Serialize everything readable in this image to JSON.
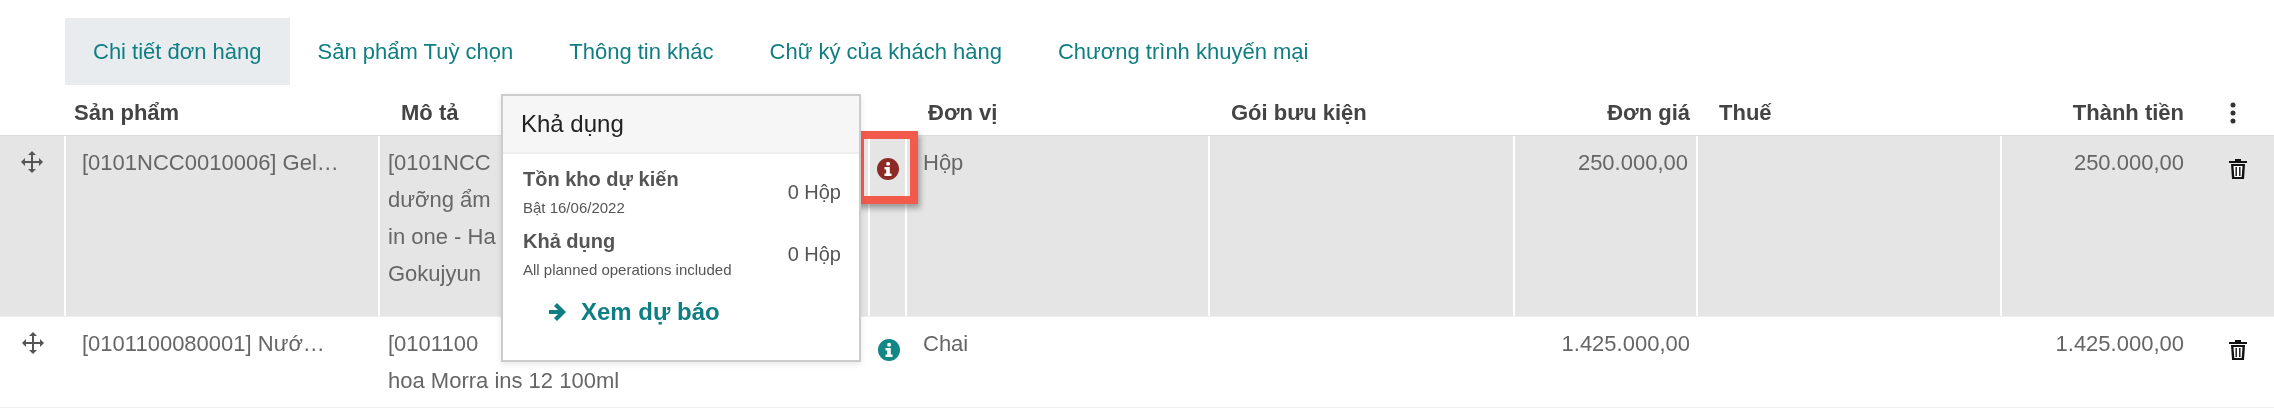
{
  "tabs": [
    {
      "label": "Chi tiết đơn hàng",
      "selected": true
    },
    {
      "label": "Sản phẩm Tuỳ chọn",
      "selected": false
    },
    {
      "label": "Thông tin khác",
      "selected": false
    },
    {
      "label": "Chữ ký của khách hàng",
      "selected": false
    },
    {
      "label": "Chương trình khuyến mại",
      "selected": false
    }
  ],
  "table": {
    "columns": [
      {
        "kind": "handle"
      },
      {
        "kind": "text",
        "label": "Sản phẩm"
      },
      {
        "kind": "text",
        "label": "Mô tả"
      },
      {
        "kind": "icon"
      },
      {
        "kind": "text",
        "label": "Đơn vị"
      },
      {
        "kind": "text",
        "label": "Gói bưu kiện"
      },
      {
        "kind": "number",
        "label": "Đơn giá"
      },
      {
        "kind": "text",
        "label": "Thuế"
      },
      {
        "kind": "number",
        "label": "Thành tiền"
      },
      {
        "kind": "menu"
      }
    ],
    "rows": [
      {
        "selected": true,
        "product": "[0101NCC0010006] Gel…",
        "description": "[0101NCC\ndưỡng ẩm\nin one - Ha\nGokujyun",
        "stock_alert": true,
        "highlighted": true,
        "unit": "Hộp",
        "price": "250.000,00",
        "total": "250.000,00"
      },
      {
        "selected": false,
        "product": "[0101100080001] Nướ…",
        "description": "[0101100\nhoa Morra ins 12 100ml",
        "stock_alert": false,
        "highlighted": false,
        "unit": "Chai",
        "price": "1.425.000,00",
        "total": "1.425.000,00"
      }
    ]
  },
  "popup": {
    "title": "Khả dụng",
    "items": [
      {
        "label": "Tồn kho dự kiến",
        "note": "Bật 16/06/2022",
        "value": "0 Hộp"
      },
      {
        "label": "Khả dụng",
        "note": "All planned operations included",
        "value": "0 Hộp"
      }
    ],
    "link": "Xem dự báo"
  }
}
